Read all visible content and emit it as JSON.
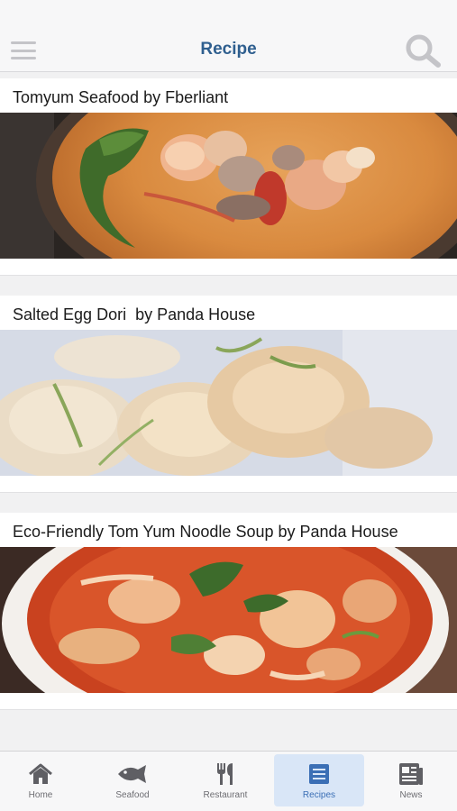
{
  "header": {
    "title": "Recipe",
    "menu_icon": "hamburger-menu-icon",
    "search_icon": "search-icon"
  },
  "recipes": [
    {
      "title": "Tomyum Seafood by Fberliant",
      "image": "tomyum-seafood-soup-photo"
    },
    {
      "title": "Salted Egg Dori  by Panda House",
      "image": "salted-egg-dori-photo"
    },
    {
      "title": "Eco-Friendly Tom Yum Noodle Soup by Panda House",
      "image": "tom-yum-noodle-soup-photo"
    }
  ],
  "tabs": [
    {
      "label": "Home",
      "icon": "home-icon",
      "active": false
    },
    {
      "label": "Seafood",
      "icon": "fish-icon",
      "active": false
    },
    {
      "label": "Restaurant",
      "icon": "fork-knife-icon",
      "active": false
    },
    {
      "label": "Recipes",
      "icon": "list-icon",
      "active": true
    },
    {
      "label": "News",
      "icon": "newspaper-icon",
      "active": false
    }
  ],
  "colors": {
    "title": "#2f5f8f",
    "active_tab_bg": "#d9e6f7",
    "active_tab": "#3b6fb5",
    "inactive_icon": "#6d6d72"
  }
}
